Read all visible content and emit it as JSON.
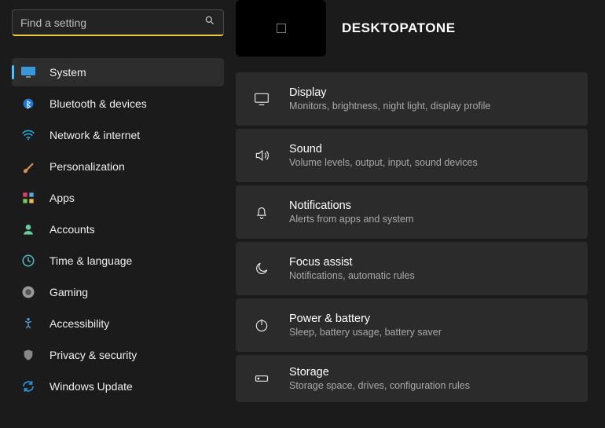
{
  "search": {
    "placeholder": "Find a setting"
  },
  "device": {
    "name": "DESKTOPATONE"
  },
  "sidebar": {
    "items": [
      {
        "id": "system",
        "label": "System",
        "active": true
      },
      {
        "id": "bluetooth",
        "label": "Bluetooth & devices"
      },
      {
        "id": "network",
        "label": "Network & internet"
      },
      {
        "id": "personalization",
        "label": "Personalization"
      },
      {
        "id": "apps",
        "label": "Apps"
      },
      {
        "id": "accounts",
        "label": "Accounts"
      },
      {
        "id": "time",
        "label": "Time & language"
      },
      {
        "id": "gaming",
        "label": "Gaming"
      },
      {
        "id": "accessibility",
        "label": "Accessibility"
      },
      {
        "id": "privacy",
        "label": "Privacy & security"
      },
      {
        "id": "update",
        "label": "Windows Update"
      }
    ]
  },
  "cards": [
    {
      "id": "display",
      "title": "Display",
      "desc": "Monitors, brightness, night light, display profile"
    },
    {
      "id": "sound",
      "title": "Sound",
      "desc": "Volume levels, output, input, sound devices"
    },
    {
      "id": "notifications",
      "title": "Notifications",
      "desc": "Alerts from apps and system"
    },
    {
      "id": "focus",
      "title": "Focus assist",
      "desc": "Notifications, automatic rules"
    },
    {
      "id": "power",
      "title": "Power & battery",
      "desc": "Sleep, battery usage, battery saver"
    },
    {
      "id": "storage",
      "title": "Storage",
      "desc": "Storage space, drives, configuration rules"
    }
  ]
}
